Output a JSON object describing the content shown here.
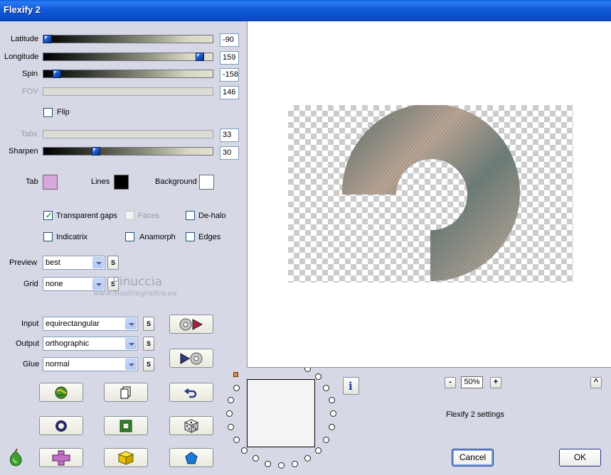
{
  "window": {
    "title": "Flexify 2"
  },
  "sliders": [
    {
      "label": "Latitude",
      "value": "-90",
      "position": 0.0,
      "enabled": true
    },
    {
      "label": "Longitude",
      "value": "159",
      "position": 0.92,
      "enabled": true
    },
    {
      "label": "Spin",
      "value": "-158",
      "position": 0.06,
      "enabled": true
    },
    {
      "label": "FOV",
      "value": "146",
      "enabled": false
    },
    {
      "label": "Tabs",
      "value": "33",
      "enabled": false
    },
    {
      "label": "Sharpen",
      "value": "30",
      "position": 0.3,
      "enabled": true
    }
  ],
  "flip": {
    "label": "Flip",
    "checked": false
  },
  "colors": {
    "tab_label": "Tab",
    "tab": "#d9a7da",
    "lines_label": "Lines",
    "lines": "#000000",
    "background_label": "Background",
    "background": "#ffffff"
  },
  "options": {
    "transparent_gaps": {
      "label": "Transparent gaps",
      "checked": true
    },
    "faces": {
      "label": "Faces",
      "checked": false,
      "enabled": false
    },
    "de_halo": {
      "label": "De-halo",
      "checked": false
    },
    "indicatrix": {
      "label": "Indicatrix",
      "checked": false
    },
    "anamorph": {
      "label": "Anamorph",
      "checked": false
    },
    "edges": {
      "label": "Edges",
      "checked": false
    }
  },
  "preview": {
    "label": "Preview",
    "value": "best"
  },
  "grid": {
    "label": "Grid",
    "value": "none"
  },
  "input": {
    "label": "Input",
    "value": "equirectangular"
  },
  "output": {
    "label": "Output",
    "value": "orthographic"
  },
  "glue": {
    "label": "Glue",
    "value": "normal"
  },
  "s_button": "S",
  "watermark": {
    "line1": "Pinuccia",
    "line2": "www.maidiregrafica.eu"
  },
  "zoom": {
    "value": "50%",
    "minus": "-",
    "plus": "+"
  },
  "up_button": "^",
  "settings_text": "Flexify 2 settings",
  "info_button": "i",
  "buttons": {
    "cancel": "Cancel",
    "ok": "OK"
  }
}
